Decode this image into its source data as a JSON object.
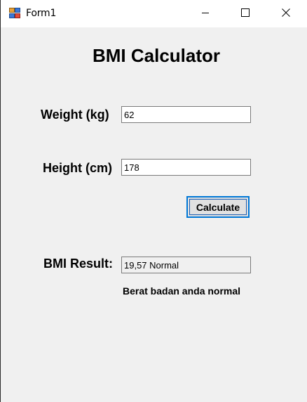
{
  "window": {
    "title": "Form1",
    "app_icon": "form-app-icon",
    "controls": {
      "minimize_icon": "minimize-icon",
      "maximize_icon": "maximize-icon",
      "close_icon": "close-icon"
    }
  },
  "form": {
    "heading": "BMI Calculator",
    "weight": {
      "label": "Weight (kg)",
      "value": "62"
    },
    "height": {
      "label": "Height (cm)",
      "value": "178"
    },
    "calculate_label": "Calculate",
    "result": {
      "label": "BMI Result:",
      "value": "19,57 Normal"
    },
    "message": "Berat badan anda normal"
  },
  "colors": {
    "form_background": "#f0f0f0",
    "titlebar_background": "#ffffff",
    "button_focus_border": "#0078d7",
    "button_background": "#e1e1e1"
  }
}
